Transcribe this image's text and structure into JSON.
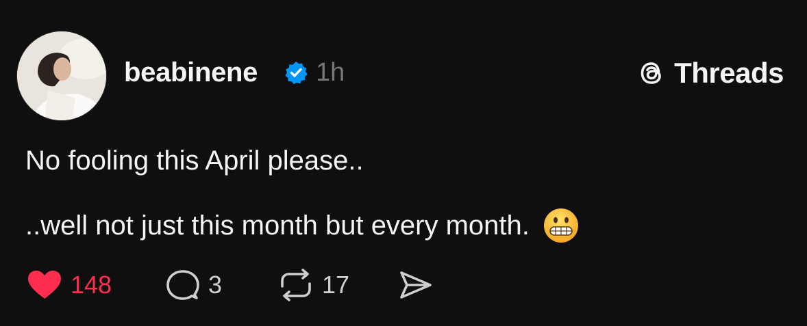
{
  "post": {
    "username": "beabinene",
    "verified": true,
    "time": "1h",
    "brand_label": "Threads",
    "text_lines": [
      "No fooling this April please..",
      "..well not just this month but every month."
    ],
    "emoji": "grimacing-face",
    "likes": "148",
    "replies": "3",
    "reposts": "17",
    "liked": true
  },
  "colors": {
    "background": "#0f0f0f",
    "text": "#f3f5f7",
    "muted": "#777777",
    "like": "#ff2e4e",
    "verified": "#0095f6"
  },
  "icons": {
    "brand": "threads-logo-icon",
    "verified": "verified-badge-icon",
    "like": "heart-icon",
    "reply": "comment-bubble-icon",
    "repost": "repost-icon",
    "share": "send-icon"
  }
}
